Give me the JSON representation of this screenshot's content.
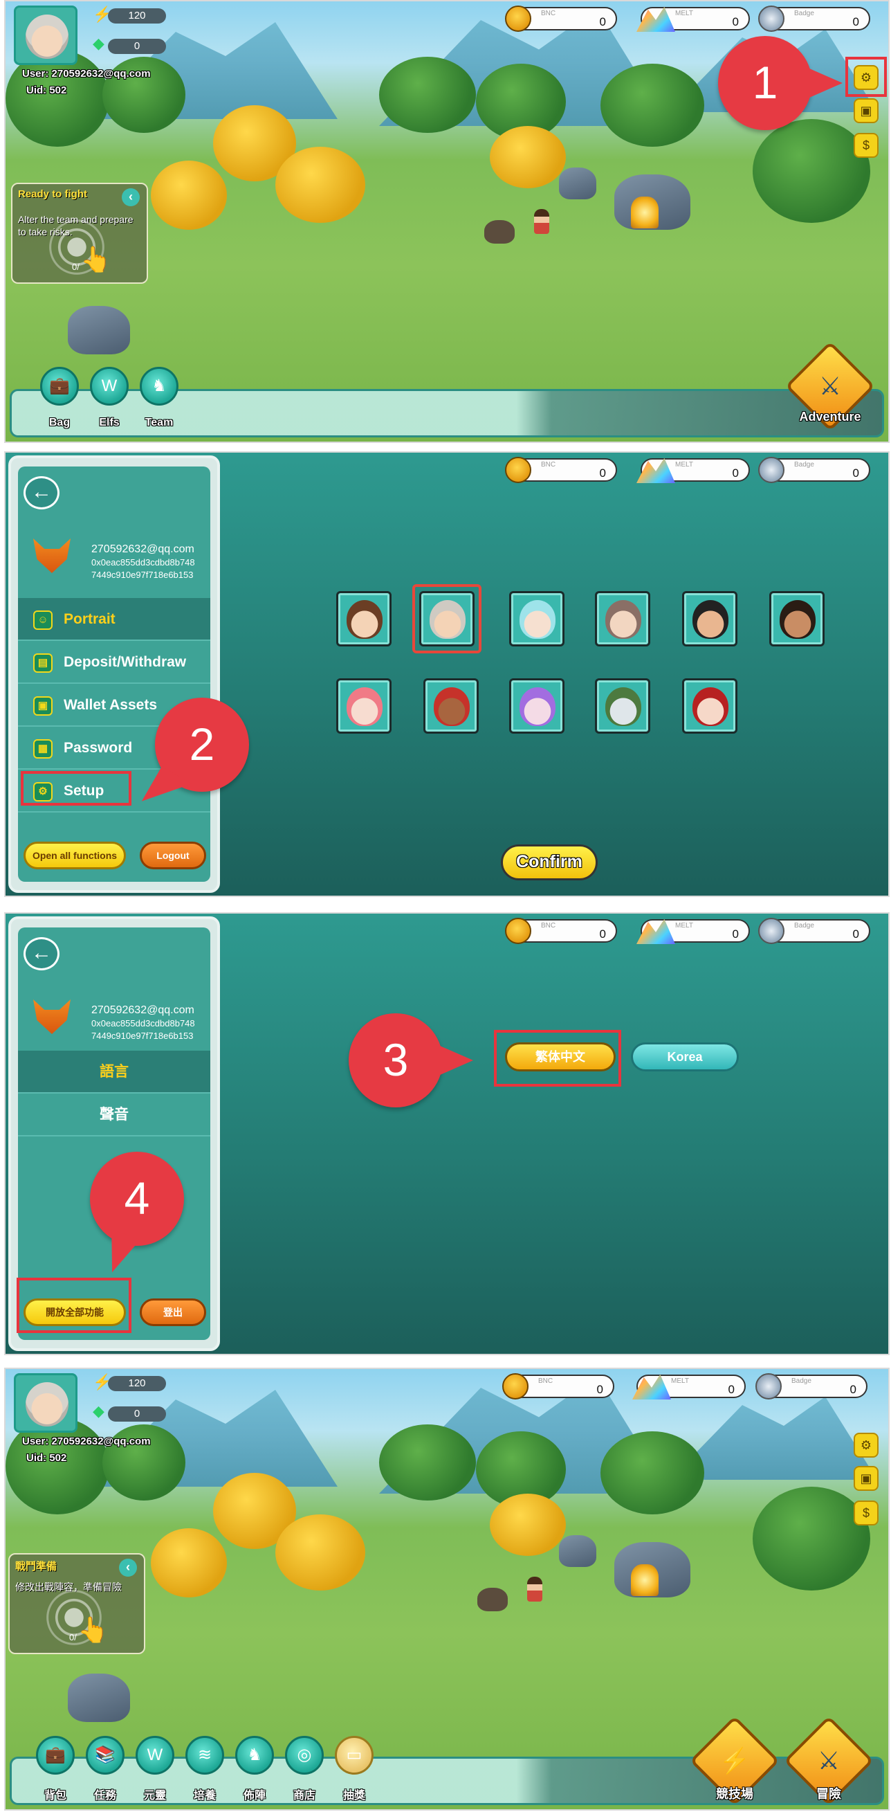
{
  "currencies": {
    "bnc_label": "BNC",
    "melt_label": "MELT",
    "badge_label": "Badge",
    "bnc_value": "0",
    "melt_value": "0",
    "badge_value": "0"
  },
  "player": {
    "energy": "120",
    "gems": "0",
    "user": "User:  270592632@qq.com",
    "uid": "Uid:  502"
  },
  "screen1": {
    "fight_title": "Ready to fight",
    "fight_desc": "Alter the team and prepare to take risks.",
    "fight_count": "0/",
    "nav": [
      "Bag",
      "Elfs",
      "Team"
    ],
    "adventure": "Adventure"
  },
  "account": {
    "email": "270592632@qq.com",
    "address_line1": "0x0eac855dd3cdbd8b748",
    "address_line2": "7449c910e97f718e6b153"
  },
  "screen2": {
    "menu": [
      "Portrait",
      "Deposit/Withdraw",
      "Wallet Assets",
      "Password",
      "Setup"
    ],
    "open_all": "Open all functions",
    "logout": "Logout",
    "confirm": "Confirm"
  },
  "screen3": {
    "menu": [
      "語言",
      "聲音"
    ],
    "languages": [
      "繁体中文",
      "Korea"
    ],
    "open_all": "開放全部功能",
    "logout": "登出"
  },
  "screen4": {
    "fight_title": "戰鬥準備",
    "fight_desc": "修改出戰陣容，準備冒險",
    "fight_count": "0/",
    "nav": [
      "背包",
      "任務",
      "元靈",
      "培養",
      "佈陣",
      "商店",
      "抽獎"
    ],
    "arena": "競技場",
    "adventure": "冒險"
  },
  "steps": [
    "1",
    "2",
    "3",
    "4"
  ],
  "colors": {
    "highlight": "#e8343d",
    "teal_bg": "#247c74",
    "accent_yellow": "#ffd01a"
  }
}
